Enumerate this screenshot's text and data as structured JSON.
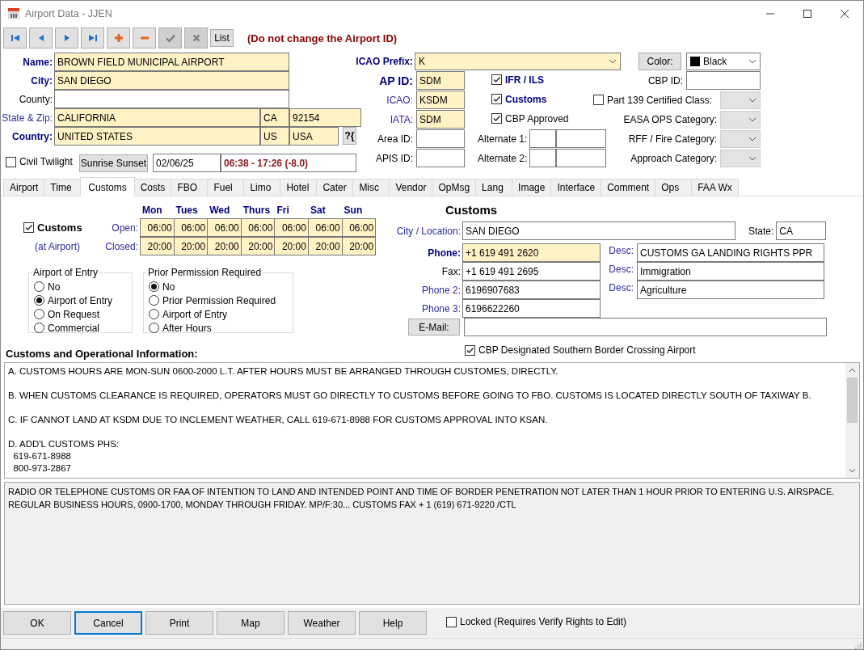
{
  "window": {
    "title": "Airport Data - JJEN"
  },
  "toolbar": {
    "buttons": [
      {
        "kind": "first",
        "disabled": false
      },
      {
        "kind": "prev",
        "disabled": false
      },
      {
        "kind": "next",
        "disabled": false
      },
      {
        "kind": "last",
        "disabled": false
      },
      {
        "kind": "add",
        "disabled": false
      },
      {
        "kind": "remove",
        "disabled": false
      },
      {
        "kind": "save",
        "disabled": true
      },
      {
        "kind": "undo",
        "disabled": true
      },
      {
        "kind": "text",
        "label": "List",
        "disabled": false
      }
    ],
    "notice": "(Do not change the Airport ID)"
  },
  "address": {
    "rows": [
      {
        "label": "Name:",
        "kind": "strong",
        "fields": [
          {
            "value": "BROWN FIELD MUNICIPAL AIRPORT",
            "required": true
          }
        ]
      },
      {
        "label": "City:",
        "kind": "strong",
        "fields": [
          {
            "value": "SAN DIEGO",
            "required": true
          }
        ]
      },
      {
        "label": "County:",
        "kind": "plain",
        "fields": [
          {
            "required": false
          }
        ]
      },
      {
        "label": "State & Zip:",
        "kind": "accent",
        "fields": [
          {
            "value": "CALIFORNIA",
            "required": true
          },
          {
            "value": "CA",
            "required": true
          },
          {
            "value": "92154",
            "required": true
          }
        ]
      },
      {
        "label": "Country:",
        "kind": "strong",
        "fields": [
          {
            "value": "UNITED STATES",
            "required": true
          },
          {
            "value": "US",
            "required": true
          },
          {
            "value": "USA",
            "required": true
          }
        ],
        "button": "?{"
      }
    ],
    "twilight": {
      "label": "Civil Twilight",
      "checked": false
    },
    "sun_button": "Sunrise Sunset",
    "date": "02/06/25",
    "times": "06:38 - 17:26 (-8.0)"
  },
  "ids": {
    "icao_prefix": {
      "label": "ICAO Prefix:",
      "value": "K"
    },
    "color": {
      "button": "Color:",
      "value": "Black"
    },
    "codes": [
      {
        "label": "AP ID:",
        "kind": "strong",
        "value": "SDM",
        "required": true
      },
      {
        "label": "ICAO:",
        "kind": "accent",
        "value": "KSDM",
        "required": true
      },
      {
        "label": "IATA:",
        "kind": "accent",
        "value": "SDM",
        "required": true
      },
      {
        "label": "Area ID:",
        "kind": "plain",
        "required": false
      },
      {
        "label": "APIS ID:",
        "kind": "plain",
        "required": false
      }
    ],
    "flags": [
      {
        "label": "IFR / ILS",
        "kind": "strong",
        "checked": true
      },
      {
        "label": "Customs",
        "kind": "strong",
        "checked": true
      },
      {
        "label": "CBP Approved",
        "kind": "plain",
        "checked": true
      }
    ],
    "alternates": [
      {
        "label": "Alternate 1:"
      },
      {
        "label": "Alternate 2:"
      }
    ],
    "cbp_id": {
      "label": "CBP ID:"
    },
    "part139": {
      "label": "Part 139 Certified Class:",
      "checked": false
    },
    "categories": [
      {
        "label": "EASA OPS Category:",
        "disabled": true
      },
      {
        "label": "RFF / Fire Category:",
        "disabled": true
      },
      {
        "label": "Approach Category:",
        "disabled": true
      }
    ]
  },
  "tabs": [
    {
      "label": "Airport",
      "selected": false
    },
    {
      "label": "Time",
      "selected": false
    },
    {
      "label": "Customs",
      "selected": true
    },
    {
      "label": "Costs",
      "selected": false
    },
    {
      "label": "FBO",
      "selected": false
    },
    {
      "label": "Fuel",
      "selected": false
    },
    {
      "label": "Limo",
      "selected": false
    },
    {
      "label": "Hotel",
      "selected": false
    },
    {
      "label": "Cater",
      "selected": false
    },
    {
      "label": "Misc",
      "selected": false
    },
    {
      "label": "Vendor",
      "selected": false
    },
    {
      "label": "OpMsg",
      "selected": false
    },
    {
      "label": "Lang",
      "selected": false
    },
    {
      "label": "Image",
      "selected": false
    },
    {
      "label": "Interface",
      "selected": false
    },
    {
      "label": "Comment",
      "selected": false
    },
    {
      "label": "Ops",
      "selected": false
    },
    {
      "label": "FAA Wx",
      "selected": false
    }
  ],
  "customs": {
    "check": {
      "label": "Customs",
      "checked": true,
      "note": "(at Airport)"
    },
    "days": [
      "Mon",
      "Tues",
      "Wed",
      "Thurs",
      "Fri",
      "Sat",
      "Sun"
    ],
    "hours": [
      {
        "label": "Open:",
        "times": [
          "06:00",
          "06:00",
          "06:00",
          "06:00",
          "06:00",
          "06:00",
          "06:00"
        ]
      },
      {
        "label": "Closed:",
        "times": [
          "20:00",
          "20:00",
          "20:00",
          "20:00",
          "20:00",
          "20:00",
          "20:00"
        ]
      }
    ],
    "groups": [
      {
        "title": "Airport of Entry",
        "options": [
          {
            "label": "No",
            "selected": false
          },
          {
            "label": "Airport of Entry",
            "selected": true
          },
          {
            "label": "On Request",
            "selected": false
          },
          {
            "label": "Commercial",
            "selected": false
          }
        ]
      },
      {
        "title": "Prior Permission Required",
        "options": [
          {
            "label": "No",
            "selected": true
          },
          {
            "label": "Prior Permission Required",
            "selected": false
          },
          {
            "label": "Airport of Entry",
            "selected": false
          },
          {
            "label": "After Hours",
            "selected": false
          }
        ]
      }
    ],
    "contact": {
      "title": "Customs",
      "city": {
        "label": "City / Location:",
        "value": "SAN DIEGO"
      },
      "state": {
        "label": "State:",
        "value": "CA"
      },
      "phones": [
        {
          "label": "Phone:",
          "kind": "strong",
          "value": "+1 619 491 2620",
          "required": true,
          "desc_label": "Desc:",
          "desc": "CUSTOMS GA LANDING RIGHTS PPR"
        },
        {
          "label": "Fax:",
          "kind": "plain",
          "value": "+1 619 491 2695",
          "required": false,
          "desc_label": "Desc:",
          "desc": "Immigration"
        },
        {
          "label": "Phone 2:",
          "kind": "accent",
          "value": "6196907683",
          "required": false,
          "desc_label": "Desc:",
          "desc": "Agriculture"
        },
        {
          "label": "Phone 3:",
          "kind": "accent",
          "value": "6196622260",
          "required": false
        }
      ],
      "email_button": "E-Mail:",
      "border_crossing": {
        "label": "CBP Designated Southern Border Crossing Airport",
        "checked": true
      }
    }
  },
  "info": {
    "label": "Customs and Operational Information:",
    "paragraphs": [
      {
        "lines": [
          "A. CUSTOMS HOURS ARE MON-SUN 0600-2000 L.T. AFTER HOURS MUST BE ARRANGED THROUGH CUSTOMES, DIRECTLY."
        ]
      },
      {
        "lines": [
          "B. WHEN CUSTOMS CLEARANCE IS REQUIRED, OPERATORS MUST GO DIRECTLY TO CUSTOMS BEFORE GOING TO FBO. CUSTOMS IS LOCATED DIRECTLY SOUTH OF TAXIWAY B."
        ]
      },
      {
        "lines": [
          "C. IF CANNOT LAND AT KSDM DUE TO INCLEMENT WEATHER, CALL 619-671-8988 FOR CUSTOMS APPROVAL INTO KSAN."
        ]
      },
      {
        "lines": [
          "D. ADD'L CUSTOMS PHS:",
          "  619-671-8988",
          "  800-973-2867"
        ]
      }
    ],
    "remarks": [
      "RADIO OR TELEPHONE CUSTOMS OR FAA OF INTENTION TO LAND AND INTENDED POINT AND TIME OF BORDER PENETRATION NOT LATER THAN 1 HOUR PRIOR TO ENTERING U.S. AIRSPACE.",
      "REGULAR BUSINESS HOURS, 0900-1700, MONDAY THROUGH FRIDAY. MP/F:30... CUSTOMS FAX + 1 (619) 671-9220 /CTL"
    ]
  },
  "footer": {
    "buttons": [
      {
        "label": "OK",
        "focused": false
      },
      {
        "label": "Cancel",
        "focused": true
      },
      {
        "label": "Print",
        "focused": false
      },
      {
        "label": "Map",
        "focused": false
      },
      {
        "label": "Weather",
        "focused": false
      },
      {
        "label": "Help",
        "focused": false
      }
    ],
    "locked": {
      "label": "Locked (Requires Verify Rights to Edit)",
      "checked": false
    }
  }
}
